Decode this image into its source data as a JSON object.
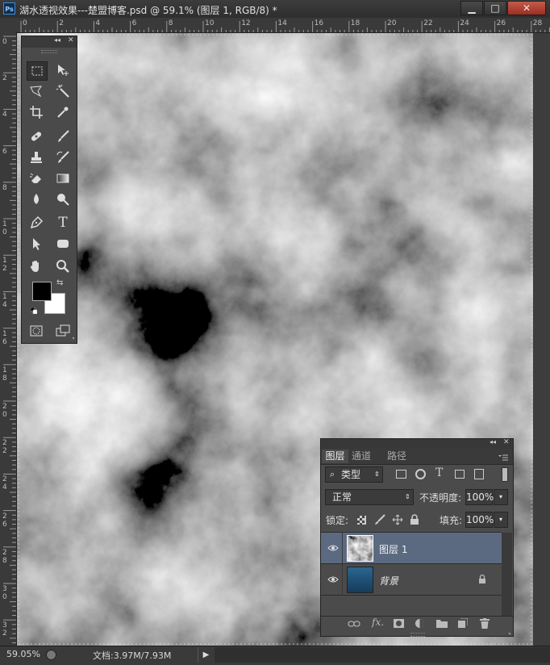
{
  "window": {
    "title": "湖水透视效果---楚盟博客.psd @ 59.1% (图层 1, RGB/8) *",
    "app_logo": "Ps",
    "minimize_label": "▁",
    "maximize_label": "□",
    "close_label": "✕"
  },
  "ruler_top": [
    "0",
    "2",
    "4",
    "6",
    "8",
    "10",
    "12",
    "14",
    "16",
    "18",
    "20",
    "22",
    "24",
    "26",
    "28"
  ],
  "ruler_left": [
    "0",
    "2",
    "4",
    "6",
    "8",
    "1 0",
    "1 2",
    "1 4",
    "1 6",
    "1 8",
    "2 0",
    "2 2",
    "2 4",
    "2 6",
    "2 8",
    "3 0",
    "3 2"
  ],
  "toolbox": {
    "collapse_label": "◂◂",
    "close_label": "✕",
    "tools": [
      "rect-marquee",
      "move",
      "polygon-lasso",
      "magic-wand",
      "crop",
      "eyedropper",
      "spot-healing-brush",
      "brush",
      "clone-stamp",
      "history-brush",
      "eraser",
      "gradient",
      "blur",
      "dodge",
      "pen",
      "type",
      "path-selection",
      "rectangle-shape",
      "hand",
      "zoom"
    ],
    "type_tool_label": "T",
    "foreground_color": "#000000",
    "background_color": "#ffffff"
  },
  "layers_panel": {
    "collapse_label": "◂◂",
    "close_label": "✕",
    "tabs": [
      "图层",
      "通道",
      "路径"
    ],
    "filter_kind": "类型",
    "filter_icon_text": "T",
    "blend_mode": "正常",
    "opacity_label": "不透明度:",
    "opacity_value": "100%",
    "lock_label": "锁定:",
    "fill_label": "填充:",
    "fill_value": "100%",
    "fx_label": "fx.",
    "layers": [
      {
        "name": "图层 1",
        "visible": true,
        "selected": true,
        "locked": false
      },
      {
        "name": "背景",
        "visible": true,
        "selected": false,
        "locked": true
      }
    ]
  },
  "status": {
    "zoom": "59.05%",
    "doc_info": "文档:3.97M/7.93M",
    "arrow": "▶"
  },
  "colors": {
    "selected_layer": "#5b6a80",
    "panel_bg": "#4b4b4b",
    "background_layer_thumb": "#1f4f77"
  }
}
